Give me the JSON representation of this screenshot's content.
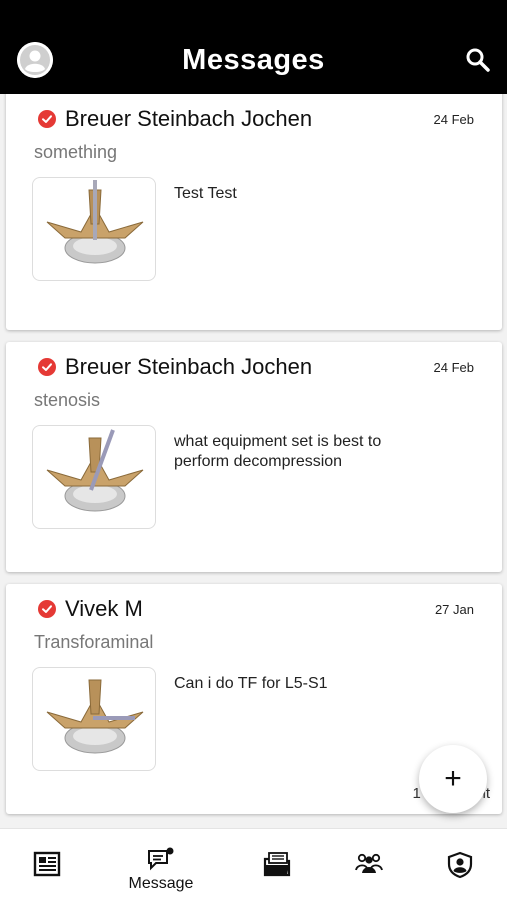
{
  "header": {
    "title": "Messages"
  },
  "posts": [
    {
      "author": "Breuer Steinbach Jochen",
      "date": "24 Feb",
      "topic": "something",
      "text": "Test Test"
    },
    {
      "author": "Breuer Steinbach Jochen",
      "date": "24 Feb",
      "topic": "stenosis",
      "text": "what equipment set is best to perform decompression"
    },
    {
      "author": "Vivek M",
      "date": "27 Jan",
      "topic": "Transforaminal",
      "text": "Can i do TF for L5-S1",
      "comments": "1 Comment"
    }
  ],
  "fab": {
    "label": "+"
  },
  "bottom_nav": [
    {
      "icon": "news-icon"
    },
    {
      "icon": "message-icon",
      "label": "Message"
    },
    {
      "icon": "folder-icon"
    },
    {
      "icon": "group-icon"
    },
    {
      "icon": "shield-user-icon"
    }
  ],
  "colors": {
    "header_bg": "#000000",
    "verified": "#e53935"
  }
}
